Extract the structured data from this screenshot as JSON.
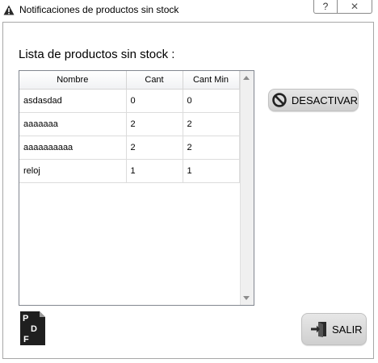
{
  "window": {
    "title": "Notificaciones de productos sin stock",
    "help_label": "?",
    "close_label": "✕"
  },
  "content": {
    "list_title": "Lista de productos sin stock :"
  },
  "table": {
    "columns": [
      "Nombre",
      "Cant",
      "Cant Min"
    ],
    "rows": [
      [
        "asdasdad",
        "0",
        "0"
      ],
      [
        "aaaaaaa",
        "2",
        "2"
      ],
      [
        "aaaaaaaaaa",
        "2",
        "2"
      ],
      [
        "reloj",
        "1",
        "1"
      ]
    ]
  },
  "buttons": {
    "desactivar_label": "DESACTIVAR",
    "salir_label": "SALIR"
  },
  "icons": {
    "pdf_letters": [
      "P",
      "D",
      "F"
    ]
  }
}
